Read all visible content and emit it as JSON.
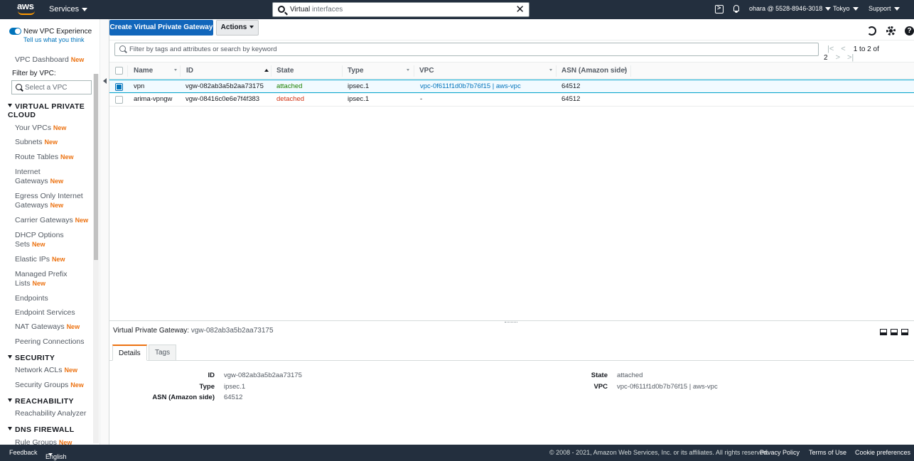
{
  "topnav": {
    "logo": "aws",
    "services": "Services",
    "search_term": "Virtual",
    "search_rest": " interfaces",
    "clear": "✕",
    "user": "ohara @ 5528-8946-3018",
    "region": "Tokyo",
    "support": "Support"
  },
  "sidebar": {
    "experience_label": "New VPC Experience",
    "experience_link": "Tell us what you think",
    "dashboard": "VPC Dashboard",
    "filter_label": "Filter by VPC:",
    "vpc_placeholder": "Select a VPC",
    "new_badge": "New",
    "sections": {
      "vpc": "VIRTUAL PRIVATE CLOUD",
      "security": "SECURITY",
      "reachability": "REACHABILITY",
      "dns_firewall": "DNS FIREWALL"
    },
    "items": {
      "your_vpcs": "Your VPCs",
      "subnets": "Subnets",
      "route_tables": "Route Tables",
      "igw_1": "Internet",
      "igw_2": "Gateways",
      "egress_1": "Egress Only Internet",
      "egress_2": "Gateways",
      "carrier": "Carrier Gateways",
      "dhcp_1": "DHCP Options",
      "dhcp_2": "Sets",
      "eips": "Elastic IPs",
      "prefix_1": "Managed Prefix",
      "prefix_2": "Lists",
      "endpoints": "Endpoints",
      "endpoint_services": "Endpoint Services",
      "nat": "NAT Gateways",
      "peering": "Peering Connections",
      "nacls": "Network ACLs",
      "sgs": "Security Groups",
      "reach_analyzer": "Reachability Analyzer",
      "rule_groups": "Rule Groups"
    }
  },
  "toolbar": {
    "create_label": "Create Virtual Private Gateway",
    "actions_label": "Actions",
    "help": "?"
  },
  "filter": {
    "placeholder": "Filter by tags and attributes or search by keyword"
  },
  "pager": {
    "first": "|<",
    "prev": "<",
    "text": "1 to 2 of 2",
    "next": ">",
    "last": ">|"
  },
  "table": {
    "columns": [
      "Name",
      "ID",
      "State",
      "Type",
      "VPC",
      "ASN (Amazon side)"
    ],
    "rows": [
      {
        "name": "vpn",
        "id": "vgw-082ab3a5b2aa73175",
        "state": "attached",
        "type": "ipsec.1",
        "vpc": "vpc-0f611f1d0b7b76f15 | aws-vpc",
        "asn": "64512"
      },
      {
        "name": "arima-vpngw",
        "id": "vgw-08416c0e6e7f4f383",
        "state": "detached",
        "type": "ipsec.1",
        "vpc": "-",
        "asn": "64512"
      }
    ]
  },
  "details": {
    "title_prefix": "Virtual Private Gateway:",
    "title_value": "vgw-082ab3a5b2aa73175",
    "tabs": [
      "Details",
      "Tags"
    ],
    "id_label": "ID",
    "id_value": "vgw-082ab3a5b2aa73175",
    "type_label": "Type",
    "type_value": "ipsec.1",
    "asn_label": "ASN (Amazon side)",
    "asn_value": "64512",
    "state_label": "State",
    "state_value": "attached",
    "vpc_label": "VPC",
    "vpc_value": "vpc-0f611f1d0b7b76f15 | aws-vpc"
  },
  "footer": {
    "feedback": "Feedback",
    "language": "English (US)",
    "copyright": "© 2008 - 2021, Amazon Web Services, Inc. or its affiliates. All rights reserved.",
    "privacy": "Privacy Policy",
    "terms": "Terms of Use",
    "cookies": "Cookie preferences"
  },
  "colors": {
    "nav_bg": "#232f3e",
    "primary": "#1166bb",
    "new_badge": "#ec7211",
    "attached": "#1d8102",
    "detached": "#d13212",
    "link": "#0073bb"
  }
}
